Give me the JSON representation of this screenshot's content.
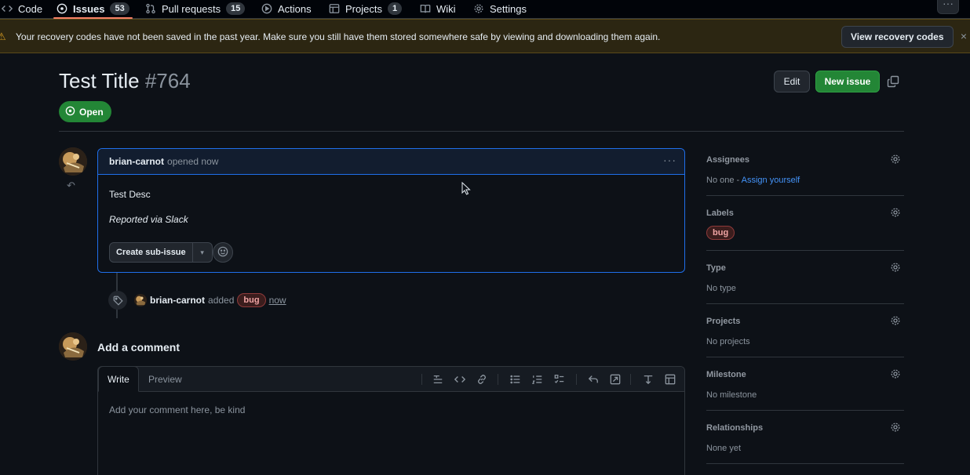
{
  "nav": {
    "tabs": [
      {
        "label": "Code",
        "icon": "code-icon"
      },
      {
        "label": "Issues",
        "icon": "issue-icon",
        "count": "53"
      },
      {
        "label": "Pull requests",
        "icon": "pull-request-icon",
        "count": "15"
      },
      {
        "label": "Actions",
        "icon": "play-icon"
      },
      {
        "label": "Projects",
        "icon": "table-icon",
        "count": "1"
      },
      {
        "label": "Wiki",
        "icon": "book-icon"
      },
      {
        "label": "Settings",
        "icon": "gear-icon"
      }
    ],
    "more_label": "···"
  },
  "banner": {
    "message": "Your recovery codes have not been saved in the past year. Make sure you still have them stored somewhere safe by viewing and downloading them again.",
    "button_label": "View recovery codes",
    "close": "×",
    "warn_icon": "⚠"
  },
  "issue": {
    "title": "Test Title",
    "number": "#764",
    "state": "Open",
    "edit_label": "Edit",
    "new_label": "New issue"
  },
  "comment": {
    "author": "brian-carnot",
    "meta": "opened now",
    "kebab": "···",
    "body": "Test Desc",
    "reported": "Reported via Slack",
    "subissue_label": "Create sub-issue",
    "subissue_caret": "▾"
  },
  "event": {
    "actor": "brian-carnot",
    "action": "added",
    "label": "bug",
    "time": "now"
  },
  "add_comment": {
    "title": "Add a comment",
    "tab_write": "Write",
    "tab_preview": "Preview",
    "placeholder": "Add your comment here, be kind"
  },
  "sidebar": {
    "assignees": {
      "title": "Assignees",
      "value": "No one - ",
      "link": "Assign yourself"
    },
    "labels": {
      "title": "Labels",
      "label": "bug"
    },
    "type": {
      "title": "Type",
      "value": "No type"
    },
    "projects": {
      "title": "Projects",
      "value": "No projects"
    },
    "milestone": {
      "title": "Milestone",
      "value": "No milestone"
    },
    "relationships": {
      "title": "Relationships",
      "value": "None yet"
    }
  },
  "colors": {
    "accent_green": "#238636",
    "link_blue": "#4493f8",
    "bg": "#0d1117",
    "warn_bg": "#2c2612",
    "label_bug_bg": "#3b1d1d"
  }
}
